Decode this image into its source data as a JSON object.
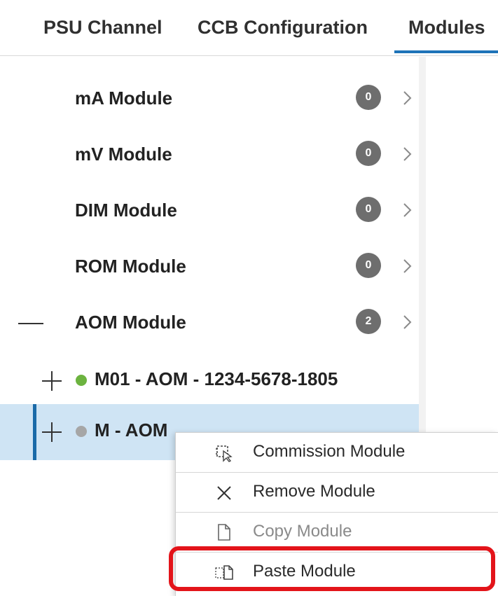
{
  "tabs": [
    {
      "label": "PSU Channel"
    },
    {
      "label": "CCB Configuration"
    },
    {
      "label": "Modules"
    }
  ],
  "modules": [
    {
      "label": "mA Module",
      "count": "0"
    },
    {
      "label": "mV Module",
      "count": "0"
    },
    {
      "label": "DIM Module",
      "count": "0"
    },
    {
      "label": "ROM Module",
      "count": "0"
    },
    {
      "label": "AOM Module",
      "count": "2",
      "expanded": true
    }
  ],
  "aom_children": [
    {
      "label": "M01 - AOM - 1234-5678-1805",
      "status_color": "#6cb33f"
    },
    {
      "label": "M - AOM",
      "status_color": "#a6a6a6",
      "selected": true
    }
  ],
  "context_menu": {
    "items": [
      {
        "label": "Commission Module",
        "icon": "commission-icon"
      },
      {
        "label": "Remove Module",
        "icon": "close-icon"
      },
      {
        "label": "Copy Module",
        "icon": "document-icon",
        "disabled": true
      },
      {
        "label": "Paste Module",
        "icon": "paste-icon",
        "highlighted": true
      }
    ]
  },
  "colors": {
    "accent": "#1e73b8",
    "selected_row": "#cfe4f4",
    "badge": "#6e6e6e",
    "highlight_outline": "#e3141a"
  }
}
